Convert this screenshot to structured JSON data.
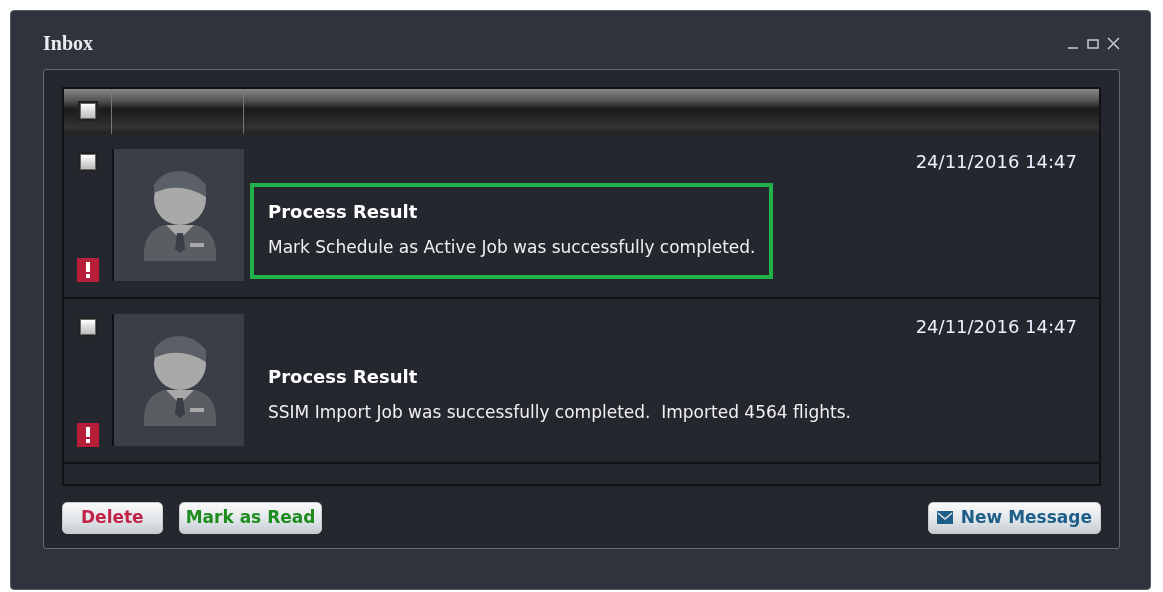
{
  "window": {
    "title": "Inbox"
  },
  "table": {
    "header_checked": false
  },
  "messages": [
    {
      "checked": false,
      "flagged": true,
      "selected": true,
      "date": "24/11/2016 14:47",
      "title": "Process Result",
      "body": "Mark Schedule as Active Job was successfully completed."
    },
    {
      "checked": false,
      "flagged": true,
      "selected": false,
      "date": "24/11/2016 14:47",
      "title": "Process Result",
      "body": "SSIM Import Job was successfully completed.  Imported 4564 flights."
    }
  ],
  "buttons": [
    {
      "label": "Delete",
      "kind": "delete"
    },
    {
      "label": "Mark as Read",
      "kind": "read"
    },
    {
      "label": "New Message",
      "kind": "new"
    }
  ]
}
